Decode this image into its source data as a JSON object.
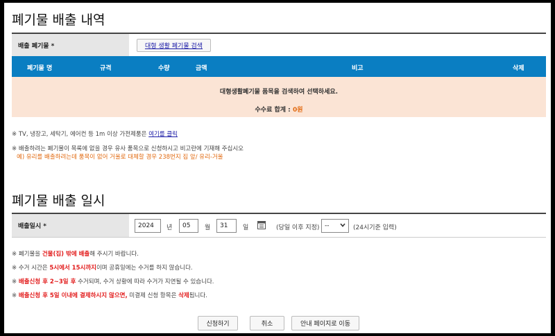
{
  "section1": {
    "title": "폐기물 배출 내역",
    "waste_label": "배출 폐기물 *",
    "search_button": "대형 생활 폐기물 검색",
    "columns": [
      "폐기물 명",
      "규격",
      "수량",
      "금액",
      "비고",
      "삭제"
    ],
    "empty_message": "대형생활폐기물 품목을 검색하여 선택하세요.",
    "fee_label": "수수료 합계 :",
    "fee_value": "0원",
    "notice1_prefix": "※ TV, 냉장고, 세탁기, 에어컨 등 1m 이상 가전제품은 ",
    "notice1_link": "여기를 클릭",
    "notice2": "※ 배출하려는 폐기물이 목록에 없을 경우 유사 품목으로 신청하시고 비고란에 기재해 주십시오",
    "notice2_example": "예) 유리를 배출하려는데 품목이 없어 거울로 대체할 경우 238번지 집 앞/ 유리-거울"
  },
  "section2": {
    "title": "폐기물 배출 일시",
    "date_label": "배출일시 *",
    "year": "2024",
    "year_unit": "년",
    "month": "05",
    "month_unit": "월",
    "day": "31",
    "day_unit": "일",
    "same_day_label": "(당일 이후 지정)",
    "time_value": "--",
    "time_hint": "(24시기준 입력)"
  },
  "notes": {
    "n1_a": "※ 폐기물을 ",
    "n1_b": "건물(집) 밖에 배출",
    "n1_c": "해 주시기 바랍니다.",
    "n2_a": "※ 수거 시간은 ",
    "n2_b": "5시에서 15시까지",
    "n2_c": "이며 공휴일에는 수거를 하지 않습니다.",
    "n3_a": "※ ",
    "n3_b": "배출신청 후 2~3일 후",
    "n3_c": " 수거되며, 수거 상황에 따라 수거가 지연될 수 있습니다.",
    "n4_a": "※ ",
    "n4_b": "배출신청 후 5일 이내에 결제하시지 않으면,",
    "n4_c": " 미결제 신청 항목은 ",
    "n4_d": "삭제",
    "n4_e": "됩니다."
  },
  "buttons": {
    "apply": "신청하기",
    "cancel": "취소",
    "guide": "안내 페이지로 이동"
  },
  "colors": {
    "header_blue": "#0a7ec2",
    "empty_row_peach": "#fbe4d5",
    "emphasis_red": "#e21b1b",
    "accent_orange": "#e26a10"
  },
  "icons": {
    "calendar": "calendar-icon",
    "dropdown": "chevron-down-icon"
  }
}
